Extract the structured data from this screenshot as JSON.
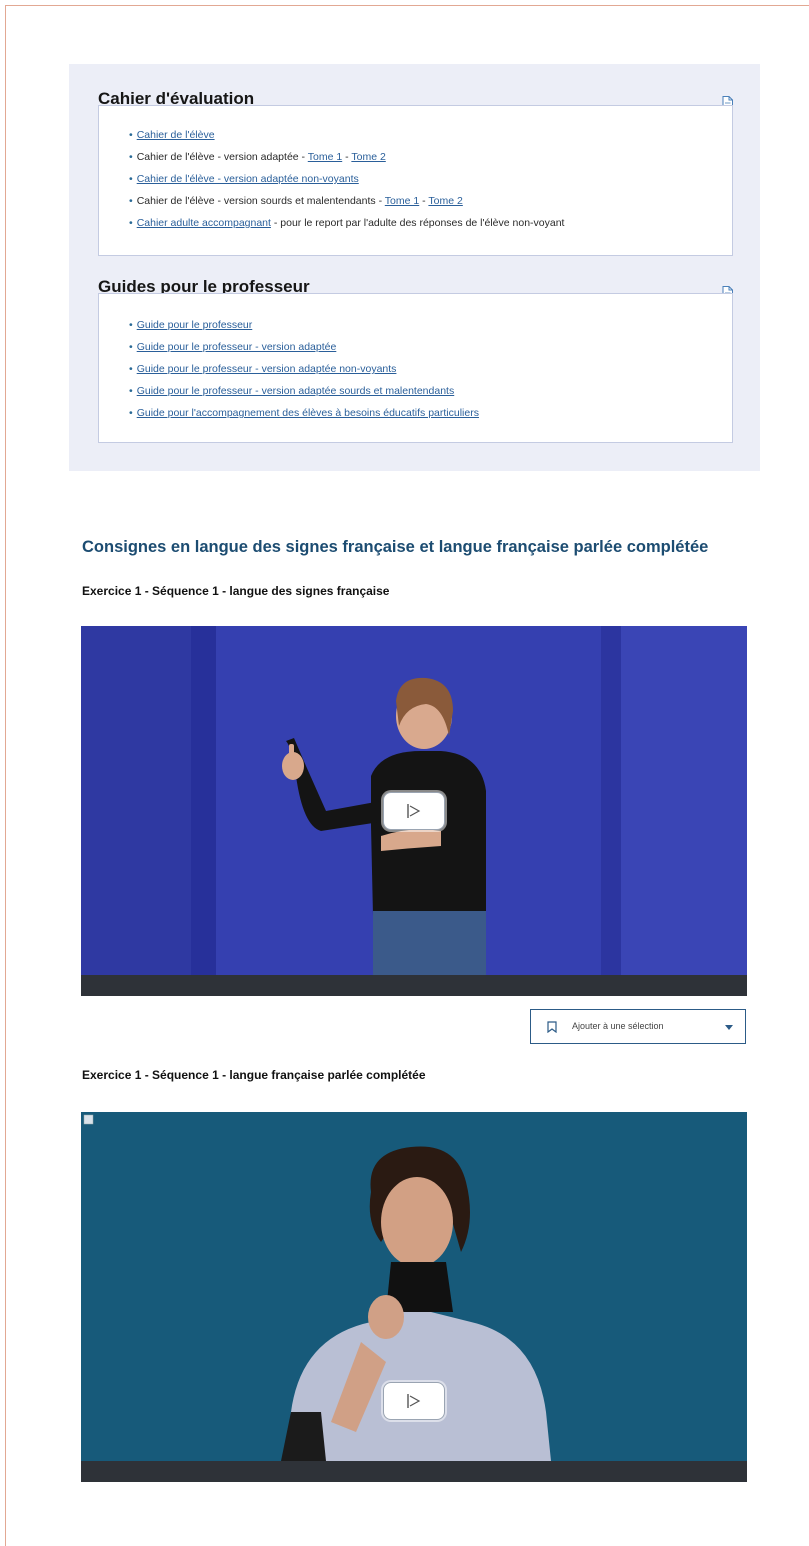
{
  "cahier": {
    "title": "Cahier d'évaluation",
    "icon": "document-icon",
    "items": [
      {
        "parts": [
          {
            "text": "Cahier de l'élève",
            "link": true
          }
        ]
      },
      {
        "parts": [
          {
            "text": "Cahier de l'élève - version adaptée - ",
            "link": false
          },
          {
            "text": "Tome 1",
            "link": true
          },
          {
            "text": " - ",
            "link": false
          },
          {
            "text": "Tome 2",
            "link": true
          }
        ]
      },
      {
        "parts": [
          {
            "text": "Cahier de l'élève - version adaptée non-voyants",
            "link": true
          }
        ]
      },
      {
        "parts": [
          {
            "text": "Cahier de l'élève - version sourds et malentendants - ",
            "link": false
          },
          {
            "text": "Tome 1",
            "link": true
          },
          {
            "text": " - ",
            "link": false
          },
          {
            "text": "Tome 2",
            "link": true
          }
        ]
      },
      {
        "parts": [
          {
            "text": "Cahier adulte accompagnant",
            "link": true
          },
          {
            "text": " - pour le report par l'adulte des réponses de l'élève non-voyant",
            "link": false
          }
        ]
      }
    ]
  },
  "guides": {
    "title": "Guides pour le professeur",
    "icon": "document-icon",
    "items": [
      {
        "parts": [
          {
            "text": "Guide pour le professeur",
            "link": true
          }
        ]
      },
      {
        "parts": [
          {
            "text": "Guide pour le professeur - version adaptée",
            "link": true
          }
        ]
      },
      {
        "parts": [
          {
            "text": "Guide pour le professeur - version adaptée non-voyants",
            "link": true
          }
        ]
      },
      {
        "parts": [
          {
            "text": "Guide pour le professeur - version adaptée sourds et malentendants",
            "link": true
          }
        ]
      },
      {
        "parts": [
          {
            "text": "Guide pour l'accompagnement des élèves à besoins éducatifs particuliers",
            "link": true
          }
        ]
      }
    ]
  },
  "consignes": {
    "heading": "Consignes en langue des signes française et langue française parlée complétée",
    "exercise1_title": "Exercice 1 - Séquence 1 - langue des signes française",
    "exercise2_title": "Exercice 1 - Séquence 1 - langue française parlée complétée",
    "add_to_selection_label": "Ajouter à une sélection"
  },
  "colors": {
    "heading_blue": "#1c4c71",
    "link_blue": "#2a5f9a",
    "panel_bg": "#eceef7",
    "video1_bg": "#3a47b8",
    "video2_bg": "#1a5b7a"
  }
}
